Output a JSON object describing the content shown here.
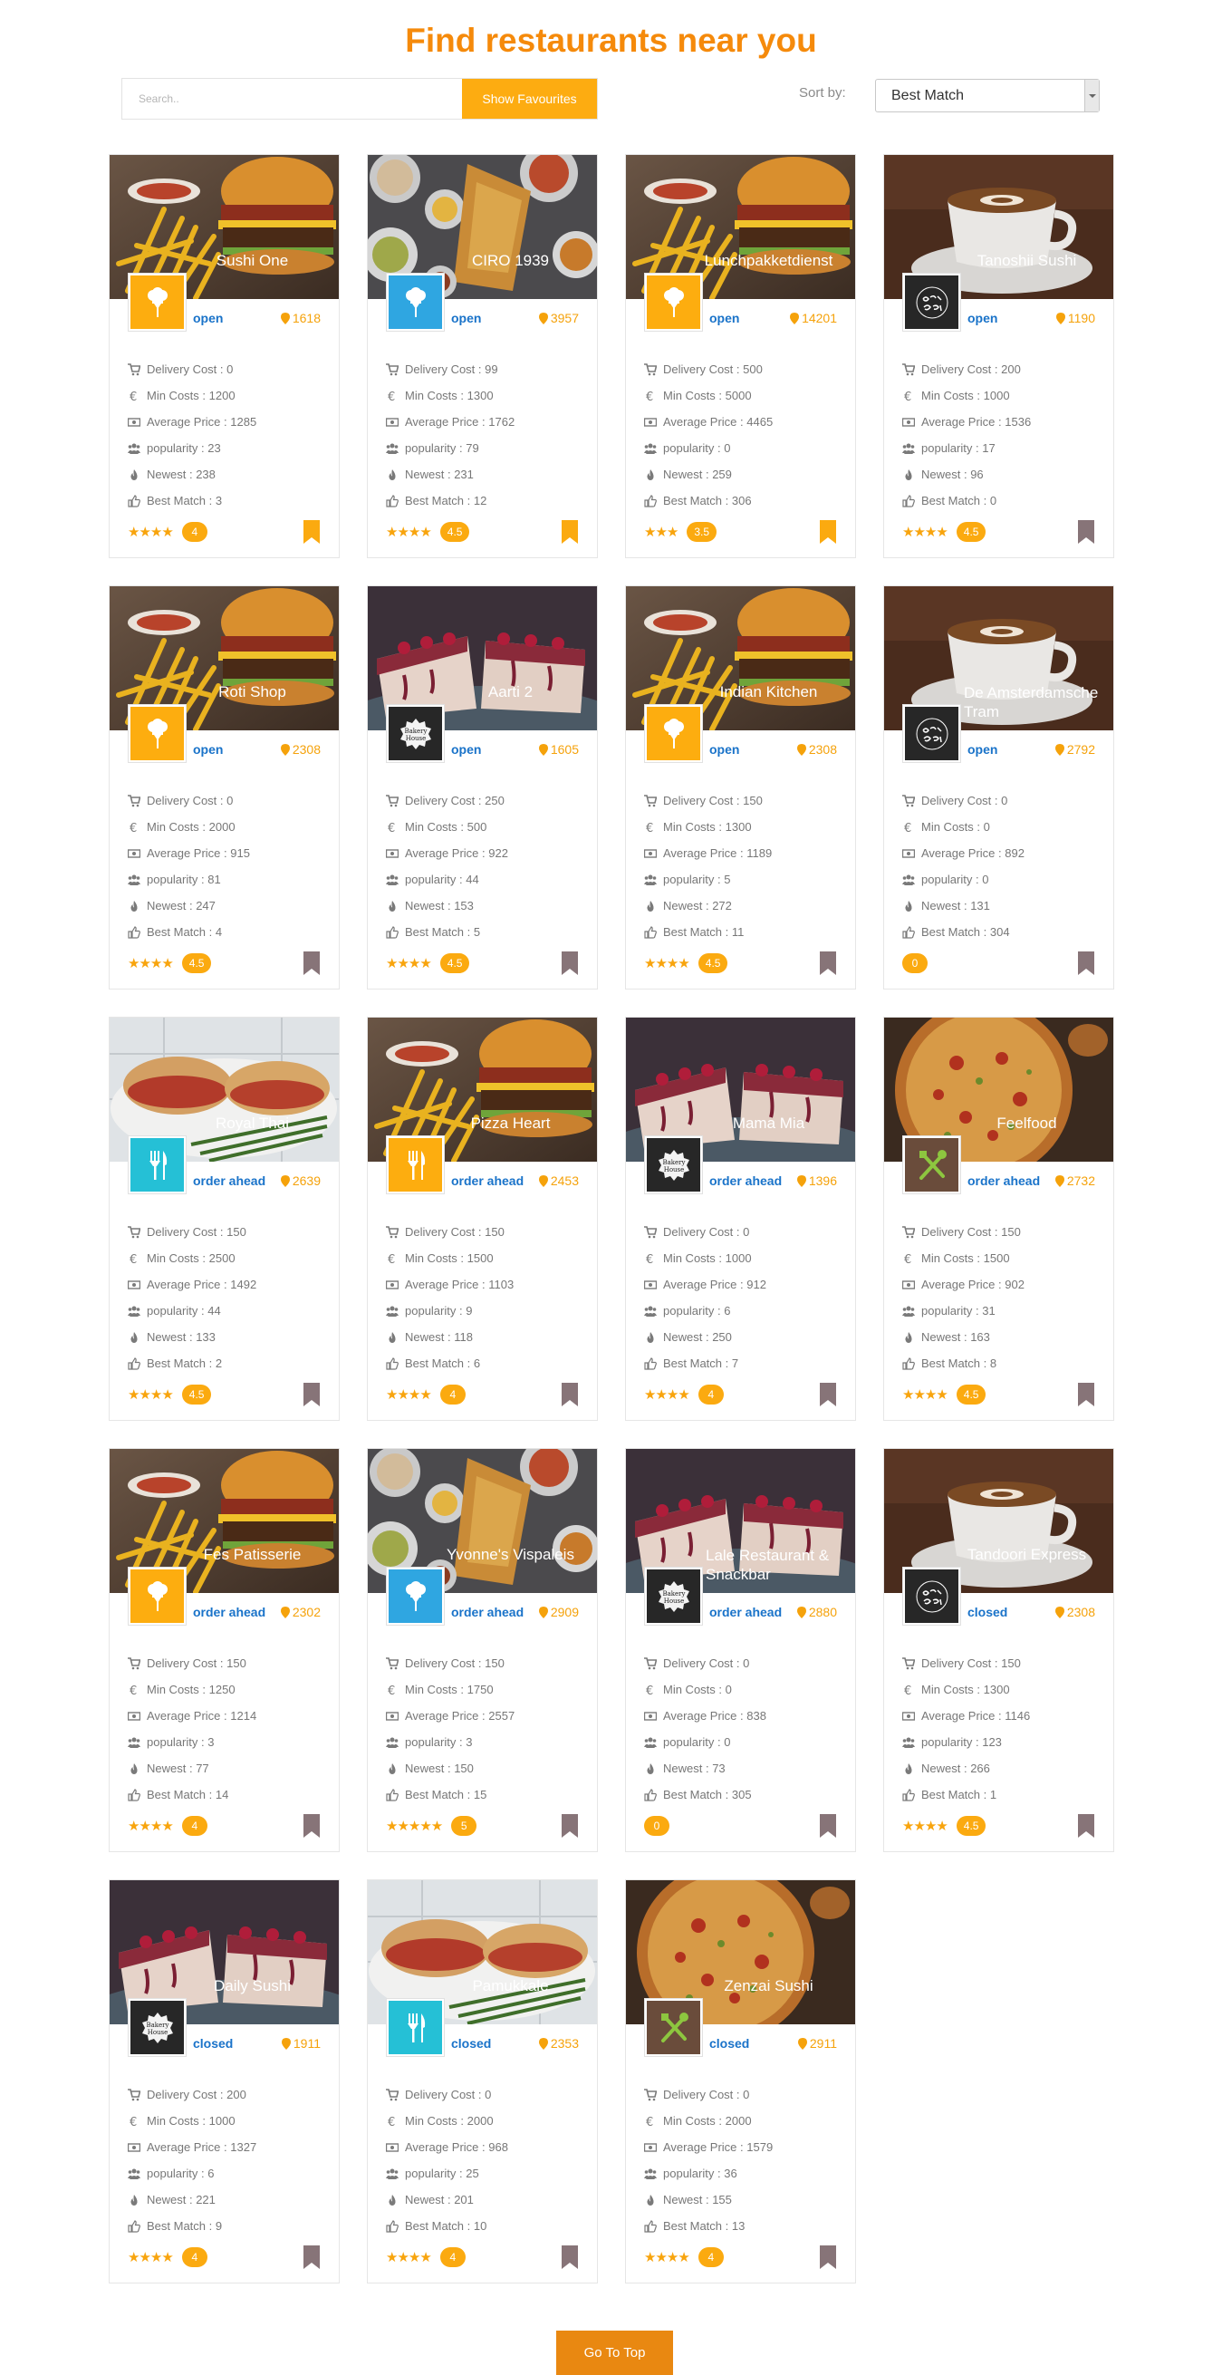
{
  "page": {
    "title": "Find restaurants near you"
  },
  "search": {
    "placeholder": "Search..",
    "favourites_label": "Show Favourites"
  },
  "sort": {
    "label": "Sort by:",
    "selected": "Best Match"
  },
  "labels": {
    "delivery_cost": "Delivery Cost : ",
    "min_costs": "Min Costs : ",
    "average_price": "Average Price : ",
    "popularity": "popularity : ",
    "newest": "Newest : ",
    "best_match": "Best Match : "
  },
  "colors": {
    "accent": "#f58a0b",
    "button": "#fdac11",
    "status_blue": "#1a73c9",
    "bookmark_active": "#fbaa10",
    "bookmark_inactive": "#877478"
  },
  "restaurants": [
    {
      "name": "Sushi One",
      "image": "burger",
      "logo": "chef-yellow",
      "status": "open",
      "distance": "1618",
      "delivery": "0",
      "min_costs": "1200",
      "avg_price": "1285",
      "popularity": "23",
      "newest": "238",
      "best_match": "3",
      "stars": "★★★★",
      "rating": "4",
      "favourite": true
    },
    {
      "name": "CIRO 1939",
      "image": "indian",
      "logo": "chef-blue",
      "status": "open",
      "distance": "3957",
      "delivery": "99",
      "min_costs": "1300",
      "avg_price": "1762",
      "popularity": "79",
      "newest": "231",
      "best_match": "12",
      "stars": "★★★★",
      "rating": "4.5",
      "favourite": true
    },
    {
      "name": "Lunchpakketdienst",
      "image": "burger",
      "logo": "chef-yellow",
      "status": "open",
      "distance": "14201",
      "delivery": "500",
      "min_costs": "5000",
      "avg_price": "4465",
      "popularity": "0",
      "newest": "259",
      "best_match": "306",
      "stars": "★★★",
      "rating": "3.5",
      "favourite": true
    },
    {
      "name": "Tanoshii Sushi",
      "image": "coffee",
      "logo": "organic-cafe",
      "status": "open",
      "distance": "1190",
      "delivery": "200",
      "min_costs": "1000",
      "avg_price": "1536",
      "popularity": "17",
      "newest": "96",
      "best_match": "0",
      "stars": "★★★★",
      "rating": "4.5",
      "favourite": false
    },
    {
      "name": "Roti Shop",
      "image": "burger",
      "logo": "chef-yellow",
      "status": "open",
      "distance": "2308",
      "delivery": "0",
      "min_costs": "2000",
      "avg_price": "915",
      "popularity": "81",
      "newest": "247",
      "best_match": "4",
      "stars": "★★★★",
      "rating": "4.5",
      "favourite": false
    },
    {
      "name": "Aarti 2",
      "image": "cake",
      "logo": "bakery-house",
      "status": "open",
      "distance": "1605",
      "delivery": "250",
      "min_costs": "500",
      "avg_price": "922",
      "popularity": "44",
      "newest": "153",
      "best_match": "5",
      "stars": "★★★★",
      "rating": "4.5",
      "favourite": false
    },
    {
      "name": "Indian Kitchen",
      "image": "burger",
      "logo": "chef-yellow",
      "status": "open",
      "distance": "2308",
      "delivery": "150",
      "min_costs": "1300",
      "avg_price": "1189",
      "popularity": "5",
      "newest": "272",
      "best_match": "11",
      "stars": "★★★★",
      "rating": "4.5",
      "favourite": false
    },
    {
      "name": "De Amsterdamsche Tram",
      "image": "coffee",
      "logo": "organic-cafe",
      "status": "open",
      "distance": "2792",
      "delivery": "0",
      "min_costs": "0",
      "avg_price": "892",
      "popularity": "0",
      "newest": "131",
      "best_match": "304",
      "stars": "",
      "rating": "0",
      "favourite": false
    },
    {
      "name": "Royal Thai",
      "image": "sandwich",
      "logo": "fork-teal",
      "status": "order ahead",
      "distance": "2639",
      "delivery": "150",
      "min_costs": "2500",
      "avg_price": "1492",
      "popularity": "44",
      "newest": "133",
      "best_match": "2",
      "stars": "★★★★",
      "rating": "4.5",
      "favourite": false
    },
    {
      "name": "Pizza Heart",
      "image": "burger",
      "logo": "fork-yellow",
      "status": "order ahead",
      "distance": "2453",
      "delivery": "150",
      "min_costs": "1500",
      "avg_price": "1103",
      "popularity": "9",
      "newest": "118",
      "best_match": "6",
      "stars": "★★★★",
      "rating": "4",
      "favourite": false
    },
    {
      "name": "Mama Mia",
      "image": "cake",
      "logo": "bakery-house",
      "status": "order ahead",
      "distance": "1396",
      "delivery": "0",
      "min_costs": "1000",
      "avg_price": "912",
      "popularity": "6",
      "newest": "250",
      "best_match": "7",
      "stars": "★★★★",
      "rating": "4",
      "favourite": false
    },
    {
      "name": "Feelfood",
      "image": "pizza",
      "logo": "utensils-brown",
      "status": "order ahead",
      "distance": "2732",
      "delivery": "150",
      "min_costs": "1500",
      "avg_price": "902",
      "popularity": "31",
      "newest": "163",
      "best_match": "8",
      "stars": "★★★★",
      "rating": "4.5",
      "favourite": false
    },
    {
      "name": "Fes Patisserie",
      "image": "burger",
      "logo": "chef-yellow",
      "status": "order ahead",
      "distance": "2302",
      "delivery": "150",
      "min_costs": "1250",
      "avg_price": "1214",
      "popularity": "3",
      "newest": "77",
      "best_match": "14",
      "stars": "★★★★",
      "rating": "4",
      "favourite": false
    },
    {
      "name": "Yvonne's Vispaleis",
      "image": "indian",
      "logo": "chef-blue",
      "status": "order ahead",
      "distance": "2909",
      "delivery": "150",
      "min_costs": "1750",
      "avg_price": "2557",
      "popularity": "3",
      "newest": "150",
      "best_match": "15",
      "stars": "★★★★★",
      "rating": "5",
      "favourite": false
    },
    {
      "name": "Lale Restaurant & Snackbar",
      "image": "cake",
      "logo": "bakery-house",
      "status": "order ahead",
      "distance": "2880",
      "delivery": "0",
      "min_costs": "0",
      "avg_price": "838",
      "popularity": "0",
      "newest": "73",
      "best_match": "305",
      "stars": "",
      "rating": "0",
      "favourite": false
    },
    {
      "name": "Tandoori Express",
      "image": "coffee",
      "logo": "organic-cafe",
      "status": "closed",
      "distance": "2308",
      "delivery": "150",
      "min_costs": "1300",
      "avg_price": "1146",
      "popularity": "123",
      "newest": "266",
      "best_match": "1",
      "stars": "★★★★",
      "rating": "4.5",
      "favourite": false
    },
    {
      "name": "Daily Sushi",
      "image": "cake",
      "logo": "bakery-house",
      "status": "closed",
      "distance": "1911",
      "delivery": "200",
      "min_costs": "1000",
      "avg_price": "1327",
      "popularity": "6",
      "newest": "221",
      "best_match": "9",
      "stars": "★★★★",
      "rating": "4",
      "favourite": false
    },
    {
      "name": "Pamukkale",
      "image": "sandwich",
      "logo": "fork-teal",
      "status": "closed",
      "distance": "2353",
      "delivery": "0",
      "min_costs": "2000",
      "avg_price": "968",
      "popularity": "25",
      "newest": "201",
      "best_match": "10",
      "stars": "★★★★",
      "rating": "4",
      "favourite": false
    },
    {
      "name": "Zenzai Sushi",
      "image": "pizza",
      "logo": "utensils-brown",
      "status": "closed",
      "distance": "2911",
      "delivery": "0",
      "min_costs": "2000",
      "avg_price": "1579",
      "popularity": "36",
      "newest": "155",
      "best_match": "13",
      "stars": "★★★★",
      "rating": "4",
      "favourite": false
    }
  ],
  "go_to_top": "Go To Top"
}
